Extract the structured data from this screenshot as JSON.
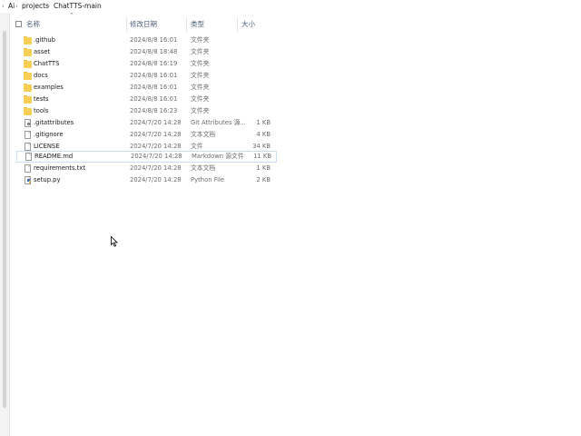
{
  "breadcrumb": {
    "items": [
      "Ai",
      "projects",
      "ChatTTS-main"
    ],
    "separator": "›"
  },
  "header": {
    "name": "名称",
    "date": "修改日期",
    "type": "类型",
    "size": "大小"
  },
  "files": [
    {
      "name": ".github",
      "date": "2024/8/8 16:01",
      "type": "文件夹",
      "size": "",
      "icon": "folder-icon"
    },
    {
      "name": "asset",
      "date": "2024/8/8 18:48",
      "type": "文件夹",
      "size": "",
      "icon": "folder-icon"
    },
    {
      "name": "ChatTTS",
      "date": "2024/8/8 16:19",
      "type": "文件夹",
      "size": "",
      "icon": "folder-icon"
    },
    {
      "name": "docs",
      "date": "2024/8/8 16:01",
      "type": "文件夹",
      "size": "",
      "icon": "folder-icon"
    },
    {
      "name": "examples",
      "date": "2024/8/8 16:01",
      "type": "文件夹",
      "size": "",
      "icon": "folder-icon"
    },
    {
      "name": "tests",
      "date": "2024/8/8 16:01",
      "type": "文件夹",
      "size": "",
      "icon": "folder-icon"
    },
    {
      "name": "tools",
      "date": "2024/8/8 16:23",
      "type": "文件夹",
      "size": "",
      "icon": "folder-icon"
    },
    {
      "name": ".gitattributes",
      "date": "2024/7/20 14:28",
      "type": "Git Attributes 源...",
      "size": "1 KB",
      "icon": "gear-file-icon"
    },
    {
      "name": ".gitignore",
      "date": "2024/7/20 14:28",
      "type": "文本文档",
      "size": "4 KB",
      "icon": "file-icon"
    },
    {
      "name": "LICENSE",
      "date": "2024/7/20 14:28",
      "type": "文件",
      "size": "34 KB",
      "icon": "file-icon"
    },
    {
      "name": "README.md",
      "date": "2024/7/20 14:28",
      "type": "Markdown 源文件",
      "size": "11 KB",
      "icon": "file-icon"
    },
    {
      "name": "requirements.txt",
      "date": "2024/7/20 14:28",
      "type": "文本文档",
      "size": "1 KB",
      "icon": "file-icon"
    },
    {
      "name": "setup.py",
      "date": "2024/7/20 14:28",
      "type": "Python File",
      "size": "2 KB",
      "icon": "python-file-icon"
    }
  ],
  "colors": {
    "folder": "#f8cf55",
    "header_text": "#4c607a",
    "hover_border": "#c8dff6"
  }
}
